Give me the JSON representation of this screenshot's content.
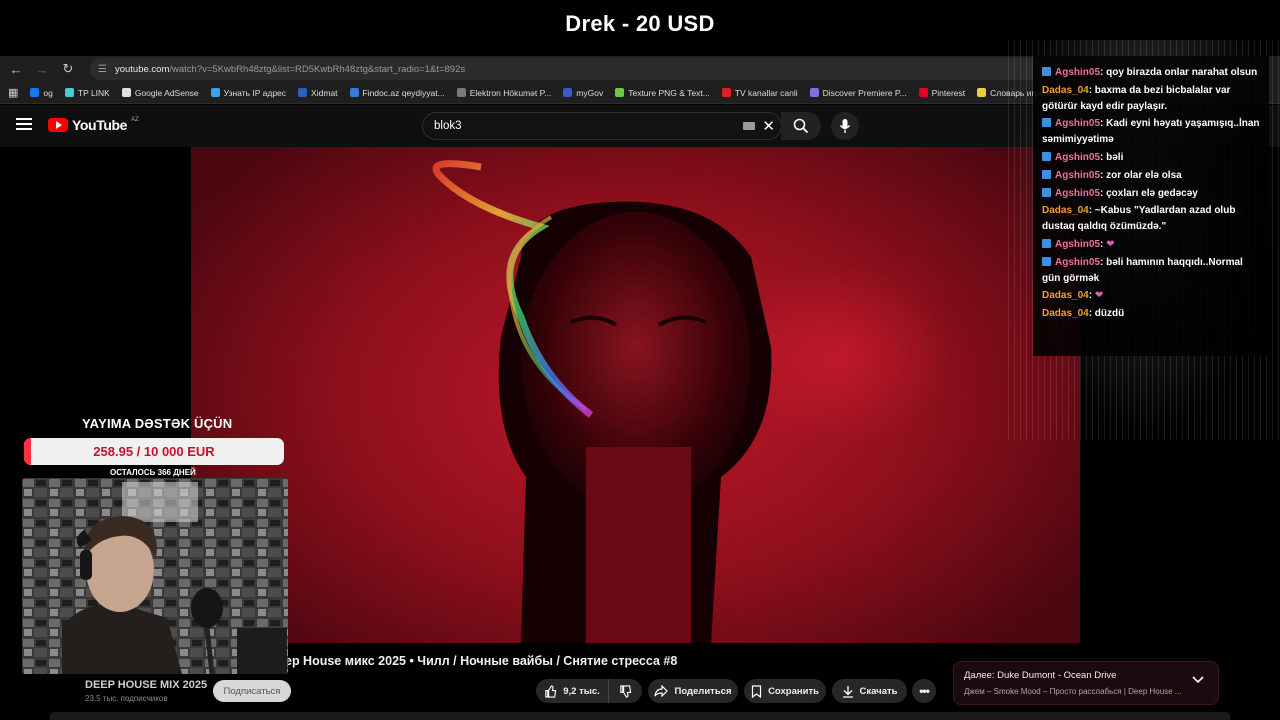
{
  "overlay_title": "Drek - 20 USD",
  "browser": {
    "url_host": "youtube.com",
    "url_rest": "/watch?v=5KwbRh48ztg&list=RD5KwbRh48ztg&start_radio=1&t=892s",
    "bookmarks": [
      {
        "label": "og",
        "color": "#1877f2"
      },
      {
        "label": "TP LINK",
        "color": "#4acbd6"
      },
      {
        "label": "Google AdSense",
        "color": "#e0e0e0"
      },
      {
        "label": "Узнать IP адрес",
        "color": "#3aa0e8"
      },
      {
        "label": "Xidmat",
        "color": "#2c5fb8"
      },
      {
        "label": "Findoc.az qeydiyyat...",
        "color": "#3a7ad6"
      },
      {
        "label": "Elektron Hökumət P...",
        "color": "#7a7a7a"
      },
      {
        "label": "myGov",
        "color": "#3a5ac8"
      },
      {
        "label": "Texture PNG & Text...",
        "color": "#6cc84a"
      },
      {
        "label": "TV kanallar canli",
        "color": "#e02020"
      },
      {
        "label": "Discover Premiere P...",
        "color": "#8a6ae0"
      },
      {
        "label": "Pinterest",
        "color": "#e60023"
      },
      {
        "label": "Словарь игровых т...",
        "color": "#e8d040"
      }
    ]
  },
  "youtube": {
    "logo_text": "YouTube",
    "logo_region": "AZ",
    "search_value": "blok3",
    "video_title": "ep House микс 2025 • Чилл / Ночные вайбы / Снятие стресса #8",
    "channel_name": "DEEP HOUSE MIX 2025",
    "channel_subs": "23,5 тыс. подписчиков",
    "subscribe_label": "Подписаться",
    "like_count": "9,2 тыс.",
    "share_label": "Поделиться",
    "save_label": "Сохранить",
    "download_label": "Скачать",
    "up_next_prefix": "Далее:",
    "up_next_title": "Duke Dumont - Ocean Drive",
    "up_next_sub": "Джем – Smoke Mood – Просто расслабься | Deep House ..."
  },
  "chat": [
    {
      "user": "Agshin05",
      "color": "pink",
      "icon": true,
      "text": ": qoy birazda onlar narahat olsun"
    },
    {
      "user": "Dadas_04",
      "color": "orange",
      "icon": false,
      "text": ": baxma da bezi bicbalalar var götürür kayd edir paylaşır."
    },
    {
      "user": "Agshin05",
      "color": "pink",
      "icon": true,
      "text": ": Kadi eyni həyatı yaşamışıq..İnan səmimiyyətimə"
    },
    {
      "user": "Agshin05",
      "color": "pink",
      "icon": true,
      "text": ": bəli"
    },
    {
      "user": "Agshin05",
      "color": "pink",
      "icon": true,
      "text": ": zor olar elə olsa"
    },
    {
      "user": "Agshin05",
      "color": "pink",
      "icon": true,
      "text": ": çoxları elə gedəcəy"
    },
    {
      "user": "Dadas_04",
      "color": "orange",
      "icon": false,
      "text": ": ~Kabus \"Yadlardan azad olub dustaq qaldıq özümüzdə.\""
    },
    {
      "user": "Agshin05",
      "color": "pink",
      "icon": true,
      "text": ": ",
      "heart": true
    },
    {
      "user": "Agshin05",
      "color": "pink",
      "icon": true,
      "text": ": bəli hamının haqqıdı..Normal gün görmək"
    },
    {
      "user": "Dadas_04",
      "color": "orange",
      "icon": false,
      "text": ": ",
      "heart": true
    },
    {
      "user": "Dadas_04",
      "color": "orange",
      "icon": false,
      "text": ": düzdü"
    }
  ],
  "donation": {
    "title": "YAYIMA DƏSTƏK ÜÇÜN",
    "amount": "258.95 / 10 000 EUR",
    "progress": 0.026,
    "remaining": "ОСТАЛОСЬ 366 ДНЕЙ"
  },
  "colors": {
    "accent_red": "#ff0000",
    "chat_pink": "#f06fa0",
    "chat_orange": "#f0a030",
    "donation_red": "#ff3040"
  }
}
